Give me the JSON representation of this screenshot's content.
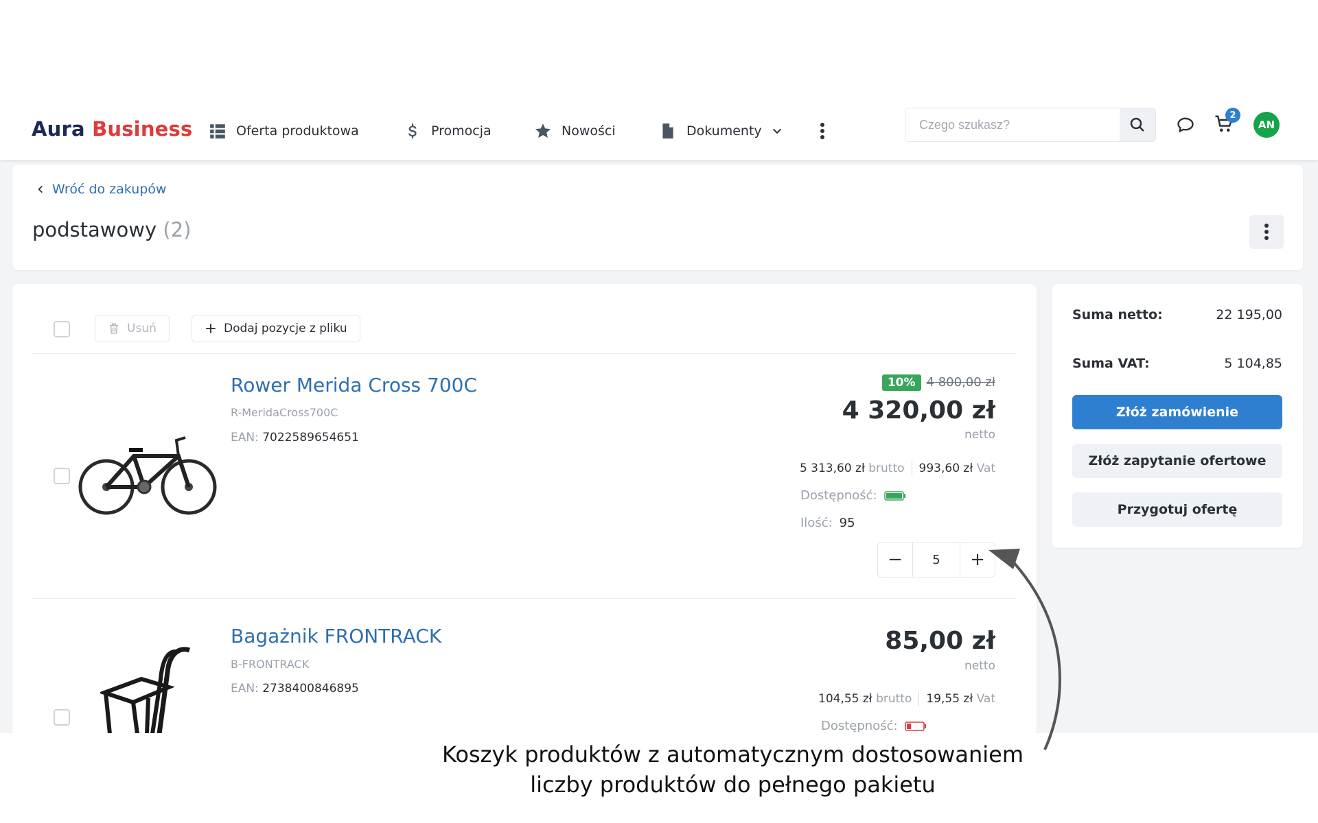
{
  "brand": {
    "part1": "Aura",
    "part2": "Business"
  },
  "nav": {
    "items": [
      {
        "label": "Oferta produktowa",
        "icon": "grid-list-icon"
      },
      {
        "label": "Promocja",
        "icon": "dollar-icon"
      },
      {
        "label": "Nowości",
        "icon": "star-icon"
      },
      {
        "label": "Dokumenty",
        "icon": "document-icon"
      }
    ]
  },
  "search": {
    "placeholder": "Czego szukasz?"
  },
  "cart": {
    "count": "2"
  },
  "user": {
    "initials": "AN"
  },
  "page": {
    "back_label": "Wróć do zakupów",
    "title": "podstawowy",
    "count": "(2)"
  },
  "toolbar": {
    "delete_label": "Usuń",
    "add_file_label": "Dodaj pozycje z pliku"
  },
  "products": [
    {
      "name": "Rower Merida Cross 700C",
      "code": "R-MeridaCross700C",
      "ean_label": "EAN:",
      "ean": "7022589654651",
      "discount": "10%",
      "old_price": "4 800,00 zł",
      "price": "4 320,00 zł",
      "price_type": "netto",
      "gross": "5 313,60 zł",
      "gross_label": "brutto",
      "vat": "993,60 zł",
      "vat_label": "Vat",
      "availability_label": "Dostępność:",
      "availability_level": 1.0,
      "quantity_label": "Ilość:",
      "quantity_available": "95",
      "qty_value": "5",
      "qty_minus": "−",
      "qty_plus": "+"
    },
    {
      "name": "Bagażnik FRONTRACK",
      "code": "B-FRONTRACK",
      "ean_label": "EAN:",
      "ean": "2738400846895",
      "price": "85,00 zł",
      "price_type": "netto",
      "gross": "104,55 zł",
      "gross_label": "brutto",
      "vat": "19,55 zł",
      "vat_label": "Vat",
      "availability_label": "Dostępność:",
      "availability_level": 0.25
    }
  ],
  "summary": {
    "net_label": "Suma netto:",
    "net_value": "22 195,00",
    "vat_label": "Suma VAT:",
    "vat_value": "5 104,85",
    "order_button": "Złóż zamówienie",
    "inquiry_button": "Złóż zapytanie ofertowe",
    "offer_button": "Przygotuj ofertę"
  },
  "colors": {
    "accent": "#2f7fd1",
    "brand_dark": "#1d2a55",
    "brand_red": "#e03a3a",
    "discount": "#3aa55d",
    "avatar": "#16a34a"
  },
  "caption": {
    "line1": "Koszyk produktów z automatycznym dostosowaniem",
    "line2": "liczby produktów do pełnego pakietu"
  }
}
